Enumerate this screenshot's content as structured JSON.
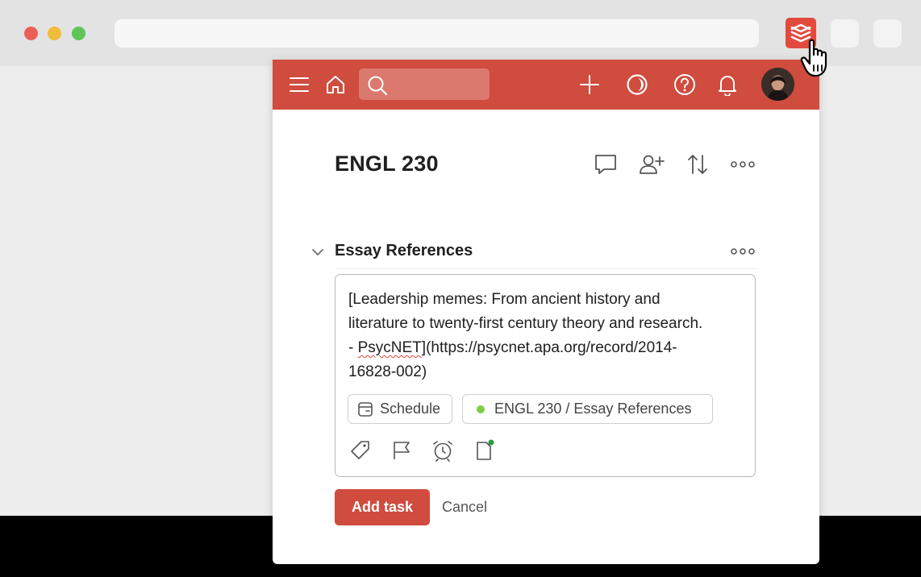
{
  "browser": {
    "traffic_lights": [
      "close",
      "minimize",
      "maximize"
    ],
    "extension_icon": "todoist-icon",
    "colors": {
      "red": "#ec5f57",
      "yellow": "#f1bc3c",
      "green": "#5ec556",
      "todoist": "#e34a3e"
    }
  },
  "topbar": {
    "color": "#cf4c3e",
    "icons": [
      "menu-icon",
      "home-icon",
      "search-icon",
      "add-icon",
      "productivity-icon",
      "help-icon",
      "notifications-icon"
    ],
    "search": {
      "value": "",
      "placeholder": ""
    }
  },
  "project": {
    "title": "ENGL 230",
    "header_icons": [
      "comment-icon",
      "share-icon",
      "sort-icon",
      "more-icon"
    ]
  },
  "section": {
    "title": "Essay References"
  },
  "task_editor": {
    "text_before": "[Leadership memes: From ancient history and\nliterature to twenty-first century theory and research.\n- ",
    "misspelled_word": "PsycNET",
    "text_after": "](https://psycnet.apa.org/record/2014-\n16828-002)",
    "schedule_label": "Schedule",
    "project_label": "ENGL 230 / Essay References",
    "project_color": "#7ecc49",
    "tool_icons": [
      "label-icon",
      "priority-flag-icon",
      "reminder-icon",
      "note-icon"
    ]
  },
  "actions": {
    "add_task_label": "Add task",
    "cancel_label": "Cancel"
  }
}
